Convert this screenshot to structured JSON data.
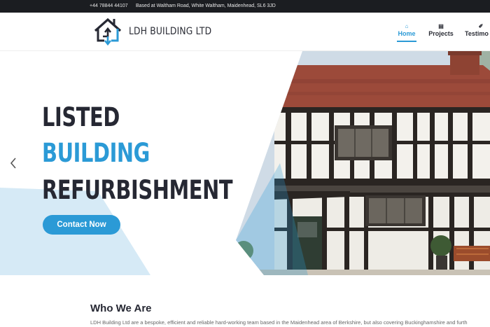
{
  "topbar": {
    "phone": "+44 78844 44107",
    "address": "Based at Waltham Road, White Waltham, Maidenhead, SL6 3JD"
  },
  "brand": {
    "name": "LDH BUILDING LTD"
  },
  "nav": [
    {
      "label": "Home",
      "icon": "home-icon",
      "active": true
    },
    {
      "label": "Projects",
      "icon": "folder-icon",
      "active": false
    },
    {
      "label": "Testimo",
      "icon": "quote-icon",
      "active": false
    }
  ],
  "hero": {
    "line1": "LISTED",
    "line2": "BUILDING",
    "line3": "REFURBISHMENT",
    "cta_label": "Contact Now"
  },
  "about": {
    "heading": "Who We Are",
    "text": "LDH Building Ltd are a bespoke, efficient and reliable hard-working team based in the Maidenhead area of Berkshire, but also covering Buckinghamshire and furth"
  },
  "colors": {
    "accent": "#2b9ad6",
    "dark": "#262833",
    "topbar": "#1b1d21"
  }
}
